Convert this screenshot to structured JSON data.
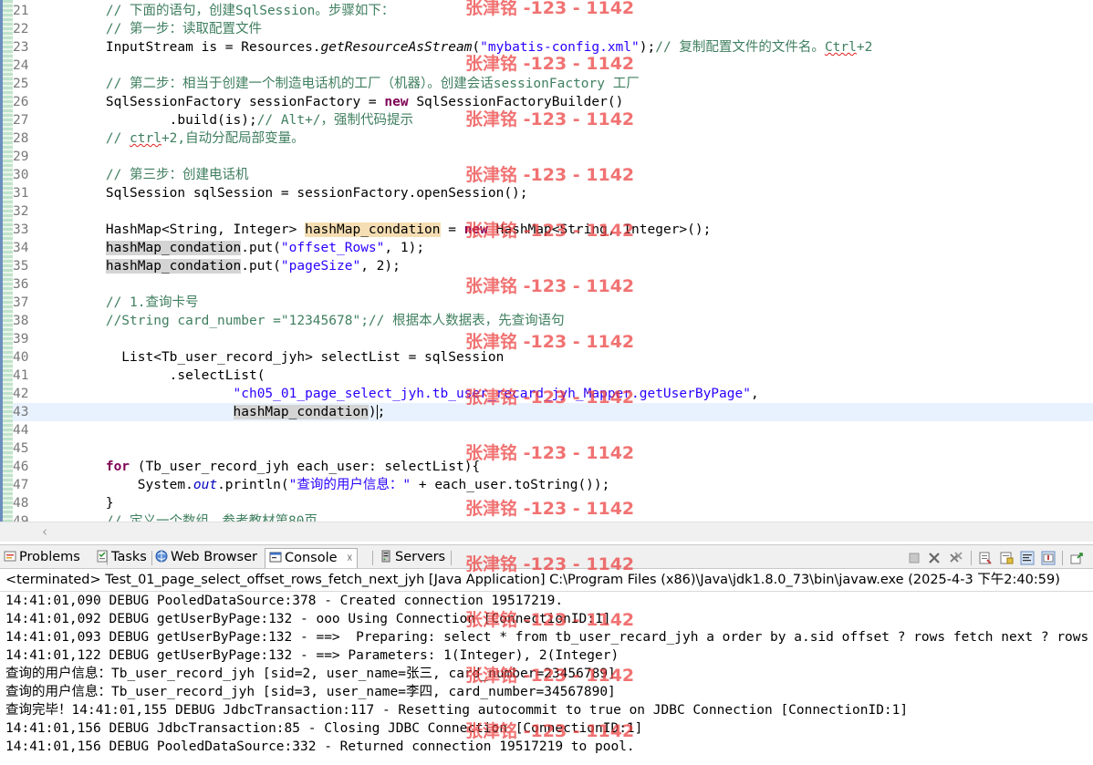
{
  "editor": {
    "lines": [
      {
        "n": "21",
        "p": [
          {
            "t": "        // 下面的语句，创建SqlSession。步骤如下：",
            "c": "c"
          }
        ]
      },
      {
        "n": "22",
        "p": [
          {
            "t": "        // 第一步：读取配置文件",
            "c": "c"
          }
        ]
      },
      {
        "n": "23",
        "p": [
          {
            "t": "        InputStream is = Resources."
          },
          {
            "t": "getResourceAsStream",
            "c": "i"
          },
          {
            "t": "("
          },
          {
            "t": "\"mybatis-config.xml\"",
            "c": "s"
          },
          {
            "t": ");"
          },
          {
            "t": "// 复制配置文件的文件名。",
            "c": "c"
          },
          {
            "t": "Ctrl",
            "c": "c sq"
          },
          {
            "t": "+2",
            "c": "c"
          }
        ]
      },
      {
        "n": "24",
        "p": []
      },
      {
        "n": "25",
        "p": [
          {
            "t": "        // 第二步：相当于创建一个制造电话机的工厂（机器）。创建会话sessionFactory 工厂",
            "c": "c"
          }
        ]
      },
      {
        "n": "26",
        "p": [
          {
            "t": "        SqlSessionFactory sessionFactory = "
          },
          {
            "t": "new",
            "c": "k"
          },
          {
            "t": " SqlSessionFactoryBuilder()"
          }
        ]
      },
      {
        "n": "27",
        "p": [
          {
            "t": "                .build(is);"
          },
          {
            "t": "// Alt+/，强制代码提示",
            "c": "c"
          }
        ]
      },
      {
        "n": "28",
        "p": [
          {
            "t": "        // ",
            "c": "c"
          },
          {
            "t": "ctrl",
            "c": "c sq"
          },
          {
            "t": "+2,自动分配局部变量。",
            "c": "c"
          }
        ]
      },
      {
        "n": "29",
        "p": []
      },
      {
        "n": "30",
        "p": [
          {
            "t": "        // 第三步：创建电话机",
            "c": "c"
          }
        ]
      },
      {
        "n": "31",
        "p": [
          {
            "t": "        SqlSession sqlSession = sessionFactory.openSession();"
          }
        ]
      },
      {
        "n": "32",
        "p": []
      },
      {
        "n": "33",
        "p": [
          {
            "t": "        HashMap<String, Integer> "
          },
          {
            "t": "hashMap_condation",
            "c": "hl"
          },
          {
            "t": " = "
          },
          {
            "t": "new",
            "c": "k"
          },
          {
            "t": " HashMap<String, Integer>();"
          }
        ]
      },
      {
        "n": "34",
        "p": [
          {
            "t": "        "
          },
          {
            "t": "hashMap_condation",
            "c": "hlg"
          },
          {
            "t": ".put("
          },
          {
            "t": "\"offset_Rows\"",
            "c": "s"
          },
          {
            "t": ", 1);"
          }
        ]
      },
      {
        "n": "35",
        "p": [
          {
            "t": "        "
          },
          {
            "t": "hashMap_condation",
            "c": "hlg"
          },
          {
            "t": ".put("
          },
          {
            "t": "\"pageSize\"",
            "c": "s"
          },
          {
            "t": ", 2);"
          }
        ]
      },
      {
        "n": "36",
        "p": []
      },
      {
        "n": "37",
        "p": [
          {
            "t": "        // 1.查询卡号",
            "c": "c"
          }
        ]
      },
      {
        "n": "38",
        "p": [
          {
            "t": "        //String card_number =\"12345678\";// 根据本人数据表，先查询语句",
            "c": "c"
          }
        ]
      },
      {
        "n": "39",
        "p": []
      },
      {
        "n": "40",
        "p": [
          {
            "t": "          List<Tb_user_record_jyh> selectList = sqlSession"
          }
        ]
      },
      {
        "n": "41",
        "p": [
          {
            "t": "                .selectList("
          }
        ]
      },
      {
        "n": "42",
        "p": [
          {
            "t": "                        "
          },
          {
            "t": "\"ch05_01_page_select_jyh.tb_user_recard_jyh_Mapper.getUserByPage\"",
            "c": "s"
          },
          {
            "t": ","
          }
        ]
      },
      {
        "n": "43",
        "cur": true,
        "p": [
          {
            "t": "                        "
          },
          {
            "t": "hashMap_condation",
            "c": "hlg"
          },
          {
            "t": ")",
            "caret": true
          },
          {
            "t": ";"
          }
        ]
      },
      {
        "n": "44",
        "p": []
      },
      {
        "n": "45",
        "p": []
      },
      {
        "n": "46",
        "p": [
          {
            "t": "        "
          },
          {
            "t": "for",
            "c": "k"
          },
          {
            "t": " (Tb_user_record_jyh each_user: selectList){"
          }
        ]
      },
      {
        "n": "47",
        "p": [
          {
            "t": "            System."
          },
          {
            "t": "out",
            "c": "f"
          },
          {
            "t": ".println("
          },
          {
            "t": "\"查询的用户信息：\"",
            "c": "s"
          },
          {
            "t": " + each_user.toString());"
          }
        ]
      },
      {
        "n": "48",
        "p": [
          {
            "t": "        }"
          }
        ]
      },
      {
        "n": "49",
        "p": [
          {
            "t": "        // 定义一个数组，参考教材第80页",
            "c": "c"
          }
        ]
      }
    ]
  },
  "tabs": [
    {
      "label": "Problems",
      "icon": "problems-icon"
    },
    {
      "label": "Tasks",
      "icon": "tasks-icon"
    },
    {
      "label": "Web Browser",
      "icon": "web-browser-icon"
    },
    {
      "label": "Console",
      "icon": "console-icon",
      "active": true
    },
    {
      "label": "Servers",
      "icon": "servers-icon"
    }
  ],
  "console": {
    "header": "<terminated> Test_01_page_select_offset_rows_fetch_next_jyh [Java Application] C:\\Program Files (x86)\\Java\\jdk1.8.0_73\\bin\\javaw.exe (2025-4-3 下午2:40:59)",
    "lines": [
      "14:41:01,090 DEBUG PooledDataSource:378 - Created connection 19517219.",
      "14:41:01,092 DEBUG getUserByPage:132 - ooo Using Connection [ConnectionID:1]",
      "14:41:01,093 DEBUG getUserByPage:132 - ==>  Preparing: select * from tb_user_recard_jyh a order by a.sid offset ? rows fetch next ? rows only",
      "14:41:01,122 DEBUG getUserByPage:132 - ==> Parameters: 1(Integer), 2(Integer)",
      "查询的用户信息：Tb_user_record_jyh [sid=2, user_name=张三, card_number=23456789]",
      "查询的用户信息：Tb_user_record_jyh [sid=3, user_name=李四, card_number=34567890]",
      "查询完毕！14:41:01,155 DEBUG JdbcTransaction:117 - Resetting autocommit to true on JDBC Connection [ConnectionID:1]",
      "14:41:01,156 DEBUG JdbcTransaction:85 - Closing JDBC Connection [ConnectionID:1]",
      "14:41:01,156 DEBUG PooledDataSource:332 - Returned connection 19517219 to pool."
    ]
  },
  "watermark": {
    "text": "张津铭 -123 - 1142"
  },
  "colors": {
    "comment": "#3f7f5f",
    "string": "#2a00ff",
    "keyword": "#7f0055",
    "field": "#0000c0",
    "watermark": "#eb3c3c"
  }
}
